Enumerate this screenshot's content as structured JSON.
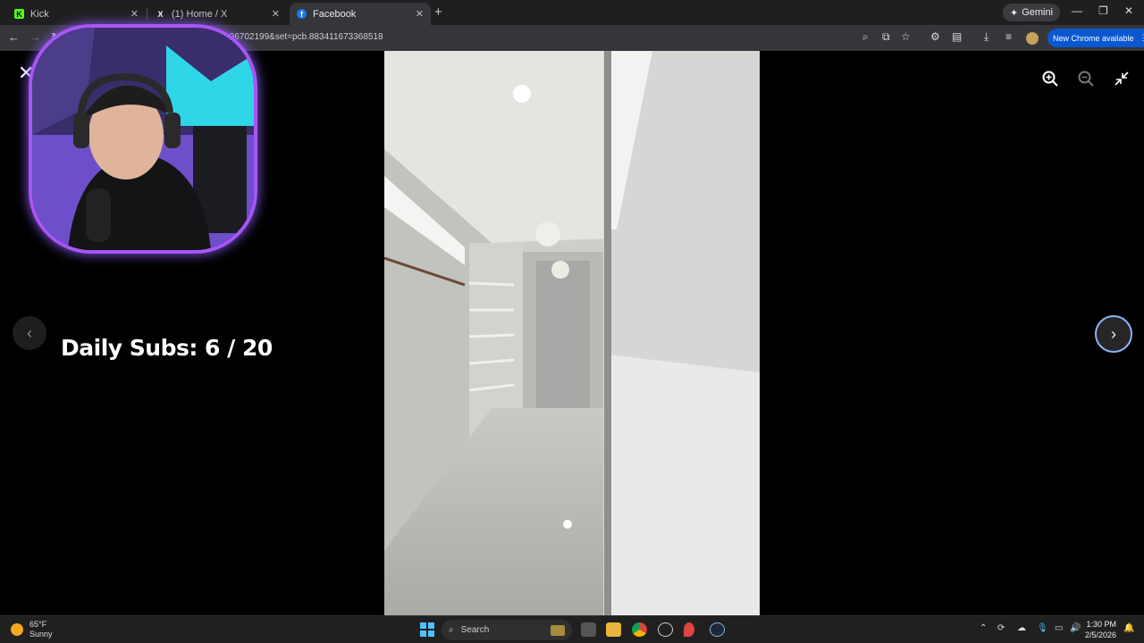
{
  "browser": {
    "tabs": [
      {
        "label": "Kick",
        "favicon": "K",
        "favicon_color": "#53fc18",
        "active": false
      },
      {
        "label": "(1) Home / X",
        "favicon": "X",
        "favicon_color": "#ffffff",
        "active": false
      },
      {
        "label": "Facebook",
        "favicon": "f",
        "favicon_color": "#1877f2",
        "active": true
      }
    ],
    "close_glyph": "✕",
    "new_tab": "+",
    "gemini_label": "Gemini",
    "url": "08196702199&set=pcb.883411673368518",
    "new_chrome_label": "New Chrome available"
  },
  "viewer": {
    "overlay_text": "Daily Subs:  6 / 20",
    "close_glyph": "✕",
    "prev_glyph": "‹",
    "next_glyph": "›"
  },
  "taskbar": {
    "weather_temp": "65°F",
    "weather_desc": "Sunny",
    "search_label": "Search",
    "time": "1:30 PM",
    "date": "2/5/2026"
  },
  "colors": {
    "accent": "#8ab4f8",
    "new_chrome_bg": "#0b57d0",
    "webcam_border": "#a855f7"
  }
}
